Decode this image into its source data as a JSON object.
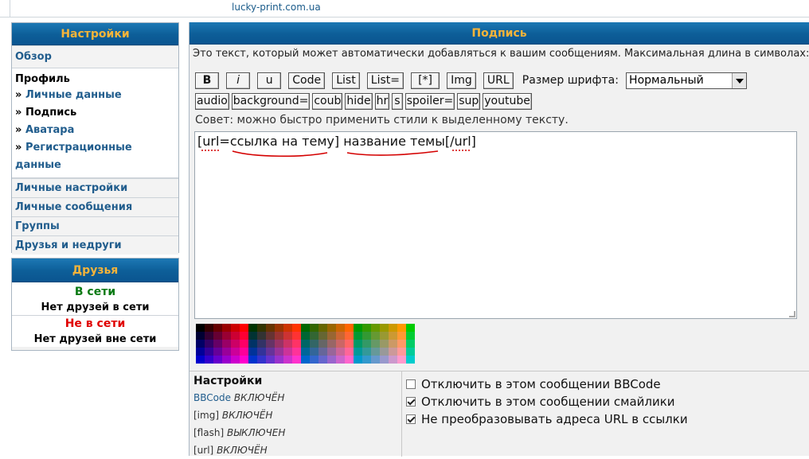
{
  "topbar": {
    "domain": "lucky-print.com.ua"
  },
  "sidebar": {
    "header": "Настройки",
    "overview": "Обзор",
    "profile": {
      "title": "Профиль",
      "items": [
        {
          "label": "Личные данные"
        },
        {
          "label": "Подпись"
        },
        {
          "label": "Аватара"
        },
        {
          "label": "Регистрационные данные"
        }
      ]
    },
    "items": [
      {
        "label": "Личные настройки"
      },
      {
        "label": "Личные сообщения"
      },
      {
        "label": "Группы"
      },
      {
        "label": "Друзья и недруги"
      }
    ]
  },
  "friends": {
    "header": "Друзья",
    "online_title": "В сети",
    "online_value": "Нет друзей в сети",
    "offline_title": "Не в сети",
    "offline_value": "Нет друзей вне сети",
    "colors": {
      "online": "#0a7a14",
      "offline": "#e00000"
    }
  },
  "main": {
    "header": "Подпись",
    "description": "Это текст, который может автоматически добавляться к вашим сообщениям. Максимальная длина в символах:",
    "toolbar_row1": [
      "B",
      "i",
      "u",
      "Code",
      "List",
      "List=",
      "[*]",
      "Img",
      "URL"
    ],
    "font_size_label": "Размер шрифта:",
    "font_size_value": "Нормальный",
    "toolbar_row2": [
      "audio",
      "background=",
      "coub",
      "hide",
      "hr",
      "s",
      "spoiler=",
      "sup",
      "youtube"
    ],
    "tip": "Совет: можно быстро применить стили к выделенному тексту.",
    "signature_text": "[url=ссылка на тему] название темы[/url]",
    "palette": [
      [
        "#000000",
        "#330000",
        "#660000",
        "#990000",
        "#cc0000",
        "#ff0000",
        "#003300",
        "#333300",
        "#663300",
        "#993300",
        "#cc3300",
        "#ff3300",
        "#006600",
        "#336600",
        "#666600",
        "#996600",
        "#cc6600",
        "#ff6600",
        "#009900",
        "#339900",
        "#669900",
        "#999900",
        "#cc9900",
        "#ff9900",
        "#00cc00"
      ],
      [
        "#000033",
        "#330033",
        "#660033",
        "#990033",
        "#cc0033",
        "#ff0033",
        "#003333",
        "#333333",
        "#663333",
        "#993333",
        "#cc3333",
        "#ff3333",
        "#006633",
        "#336633",
        "#666633",
        "#996633",
        "#cc6633",
        "#ff6633",
        "#009933",
        "#339933",
        "#669933",
        "#999933",
        "#cc9933",
        "#ff9933",
        "#00cc33"
      ],
      [
        "#000066",
        "#330066",
        "#660066",
        "#990066",
        "#cc0066",
        "#ff0066",
        "#003366",
        "#333366",
        "#663366",
        "#993366",
        "#cc3366",
        "#ff3366",
        "#006666",
        "#336666",
        "#666666",
        "#996666",
        "#cc6666",
        "#ff6666",
        "#009966",
        "#339966",
        "#669966",
        "#999966",
        "#cc9966",
        "#ff9966",
        "#00cc66"
      ],
      [
        "#000099",
        "#330099",
        "#660099",
        "#990099",
        "#cc0099",
        "#ff0099",
        "#003399",
        "#333399",
        "#663399",
        "#993399",
        "#cc3399",
        "#ff3399",
        "#006699",
        "#336699",
        "#666699",
        "#996699",
        "#cc6699",
        "#ff6699",
        "#009999",
        "#339999",
        "#669999",
        "#999999",
        "#cc9999",
        "#ff9999",
        "#00cc99"
      ],
      [
        "#0000cc",
        "#3300cc",
        "#6600cc",
        "#9900cc",
        "#cc00cc",
        "#ff00cc",
        "#0033cc",
        "#3333cc",
        "#6633cc",
        "#9933cc",
        "#cc33cc",
        "#ff33cc",
        "#0066cc",
        "#3366cc",
        "#6666cc",
        "#9966cc",
        "#cc66cc",
        "#ff66cc",
        "#0099cc",
        "#3399cc",
        "#6699cc",
        "#9999cc",
        "#cc99cc",
        "#ff99cc",
        "#00cccc"
      ]
    ]
  },
  "settings": {
    "title": "Настройки",
    "lines": [
      {
        "key": "BBCode",
        "value": "ВКЛЮЧЁН"
      },
      {
        "key": "[img]",
        "value": "ВКЛЮЧЁН"
      },
      {
        "key": "[flash]",
        "value": "ВЫКЛЮЧЕН"
      },
      {
        "key": "[url]",
        "value": "ВКЛЮЧЁН"
      }
    ],
    "options": [
      {
        "label": "Отключить в этом сообщении BBCode",
        "checked": false
      },
      {
        "label": "Отключить в этом сообщении смайлики",
        "checked": true
      },
      {
        "label": "Не преобразовывать адреса URL в ссылки",
        "checked": true
      }
    ]
  }
}
